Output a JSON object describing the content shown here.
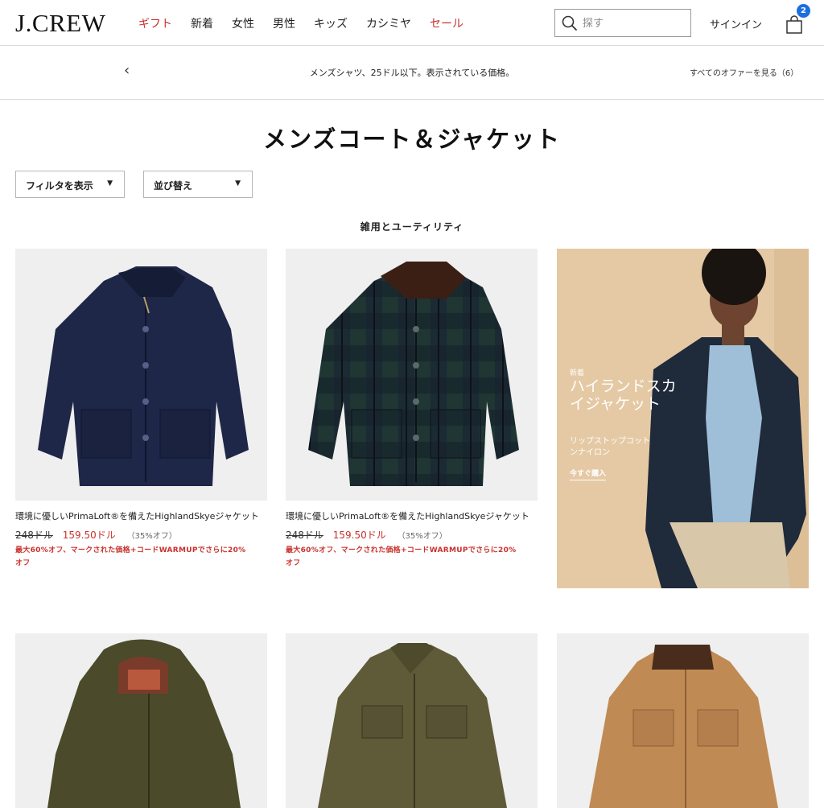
{
  "header": {
    "logo": "J.CREW",
    "nav": [
      {
        "label": "ギフト",
        "highlight": true
      },
      {
        "label": "新着",
        "highlight": false
      },
      {
        "label": "女性",
        "highlight": false
      },
      {
        "label": "男性",
        "highlight": false
      },
      {
        "label": "キッズ",
        "highlight": false
      },
      {
        "label": "カシミヤ",
        "highlight": false
      },
      {
        "label": "セール",
        "highlight": true
      }
    ],
    "search_placeholder": "探す",
    "signin": "サインイン",
    "bag_count": "2"
  },
  "promo": {
    "prev": "‹",
    "text": "メンズシャツ、25ドル以下。表示されている価格。",
    "link": "すべてのオファーを見る（6）"
  },
  "page": {
    "title": "メンズコート＆ジャケット",
    "filter_label": "フィルタを表示",
    "sort_label": "並び替え",
    "caret": "▼",
    "section_title": "雑用とユーティリティ"
  },
  "products": [
    {
      "title": "環境に優しいPrimaLoft®を備えたHighlandSkyeジャケット",
      "original_price": "248ドル",
      "sale_price": "159.50ドル",
      "discount": "（35%オフ）",
      "promo_line1": "最大60%オフ、マークされた価格+コードWARMUPでさらに20%",
      "promo_line2": "オフ"
    },
    {
      "title": "環境に優しいPrimaLoft®を備えたHighlandSkyeジャケット",
      "original_price": "248ドル",
      "sale_price": "159.50ドル",
      "discount": "（35%オフ）",
      "promo_line1": "最大60%オフ、マークされた価格+コードWARMUPでさらに20%",
      "promo_line2": "オフ"
    }
  ],
  "hero": {
    "eyebrow": "新着",
    "title": "ハイランドスカイジャケット",
    "subtitle": "リップストップコットンナイロン",
    "cta": "今すぐ購入"
  },
  "colors": {
    "brand_red": "#c8312c",
    "badge_blue": "#1a6fe0"
  }
}
